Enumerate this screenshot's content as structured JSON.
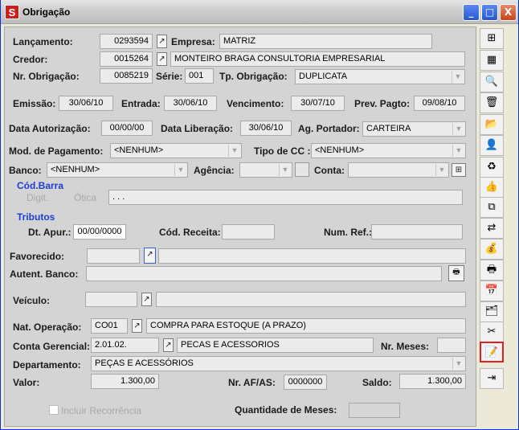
{
  "window": {
    "title": "Obrigação",
    "app_icon": "S",
    "minimize": "_",
    "maximize": "□",
    "close": "X"
  },
  "labels": {
    "lancamento": "Lançamento:",
    "empresa": "Empresa:",
    "credor": "Credor:",
    "nr_obrigacao": "Nr. Obrigação:",
    "serie": "Série:",
    "tp_obrigacao": "Tp. Obrigação:",
    "emissao": "Emissão:",
    "entrada": "Entrada:",
    "vencimento": "Vencimento:",
    "prev_pagto": "Prev. Pagto:",
    "data_autorizacao": "Data Autorização:",
    "data_liberacao": "Data Liberação:",
    "ag_portador": "Ag. Portador:",
    "mod_pagamento": "Mod. de Pagamento:",
    "tipo_cc": "Tipo de CC :",
    "banco": "Banco:",
    "agencia": "Agência:",
    "conta": "Conta:",
    "cod_barra": "Cód.Barra",
    "digit": "Digit.",
    "otica": "Ótica",
    "tributos": "Tributos",
    "dt_apur": "Dt. Apur.:",
    "cod_receita": "Cód. Receita:",
    "num_ref": "Num. Ref.:",
    "favorecido": "Favorecido:",
    "autent_banco": "Autent. Banco:",
    "veiculo": "Veículo:",
    "nat_operacao": "Nat. Operação:",
    "conta_gerencial": "Conta Gerencial:",
    "nr_meses": "Nr. Meses:",
    "departamento": "Departamento:",
    "valor": "Valor:",
    "nr_af_as": "Nr. AF/AS:",
    "saldo": "Saldo:",
    "incluir_recorrencia": "Incluir Recorrência",
    "quantidade_meses": "Quantidade de Meses:"
  },
  "values": {
    "lancamento": "0293594",
    "empresa": "MATRIZ",
    "credor_code": "0015264",
    "credor_name": "MONTEIRO BRAGA CONSULTORIA EMPRESARIAL",
    "nr_obrigacao": "0085219",
    "serie": "001",
    "tp_obrigacao": "DUPLICATA",
    "emissao": "30/06/10",
    "entrada": "30/06/10",
    "vencimento": "30/07/10",
    "prev_pagto": "09/08/10",
    "data_autorizacao": "00/00/00",
    "data_liberacao": "30/06/10",
    "ag_portador": "CARTEIRA",
    "mod_pagamento": "<NENHUM>",
    "tipo_cc": "<NENHUM>",
    "banco": "<NENHUM>",
    "agencia": "",
    "conta": "",
    "cod_barra": ".            .            .",
    "dt_apur": "00/00/0000",
    "cod_receita": "",
    "num_ref": "",
    "favorecido_code": "",
    "favorecido_name": "",
    "autent_banco": "",
    "veiculo_code": "",
    "veiculo_name": "",
    "nat_operacao_code": "CO01",
    "nat_operacao_name": "COMPRA PARA ESTOQUE (A PRAZO)",
    "conta_gerencial_code": "2.01.02.",
    "conta_gerencial_name": "PECAS E ACESSORIOS",
    "nr_meses": "",
    "departamento": "PEÇAS E ACESSÓRIOS",
    "valor": "1.300,00",
    "nr_af_as": "0000000",
    "saldo": "1.300,00",
    "quantidade_meses": ""
  },
  "toolbar": [
    {
      "name": "grid-settings-icon",
      "glyph": "⊞"
    },
    {
      "name": "add-table-icon",
      "glyph": "▦"
    },
    {
      "name": "preview-icon",
      "glyph": "🔍"
    },
    {
      "name": "delete-icon",
      "glyph": "🗑"
    },
    {
      "name": "open-folder-icon",
      "glyph": "📂"
    },
    {
      "name": "user-icon",
      "glyph": "👤"
    },
    {
      "name": "refresh-icon",
      "glyph": "♻"
    },
    {
      "name": "thumbs-up-icon",
      "glyph": "👍"
    },
    {
      "name": "copy-icon",
      "glyph": "⧉"
    },
    {
      "name": "transfer-icon",
      "glyph": "⇄"
    },
    {
      "name": "money-bag-icon",
      "glyph": "💰"
    },
    {
      "name": "print-icon",
      "glyph": "🖶"
    },
    {
      "name": "calendar-edit-icon",
      "glyph": "📅"
    },
    {
      "name": "documents-icon",
      "glyph": "🗂"
    },
    {
      "name": "attach-icon",
      "glyph": "✂"
    },
    {
      "name": "edit-document-icon",
      "glyph": "📝"
    },
    {
      "name": "exit-icon",
      "glyph": "⇥"
    }
  ],
  "colors": {
    "accent_blue": "#1c3fd0",
    "selected_border": "#e02020"
  }
}
